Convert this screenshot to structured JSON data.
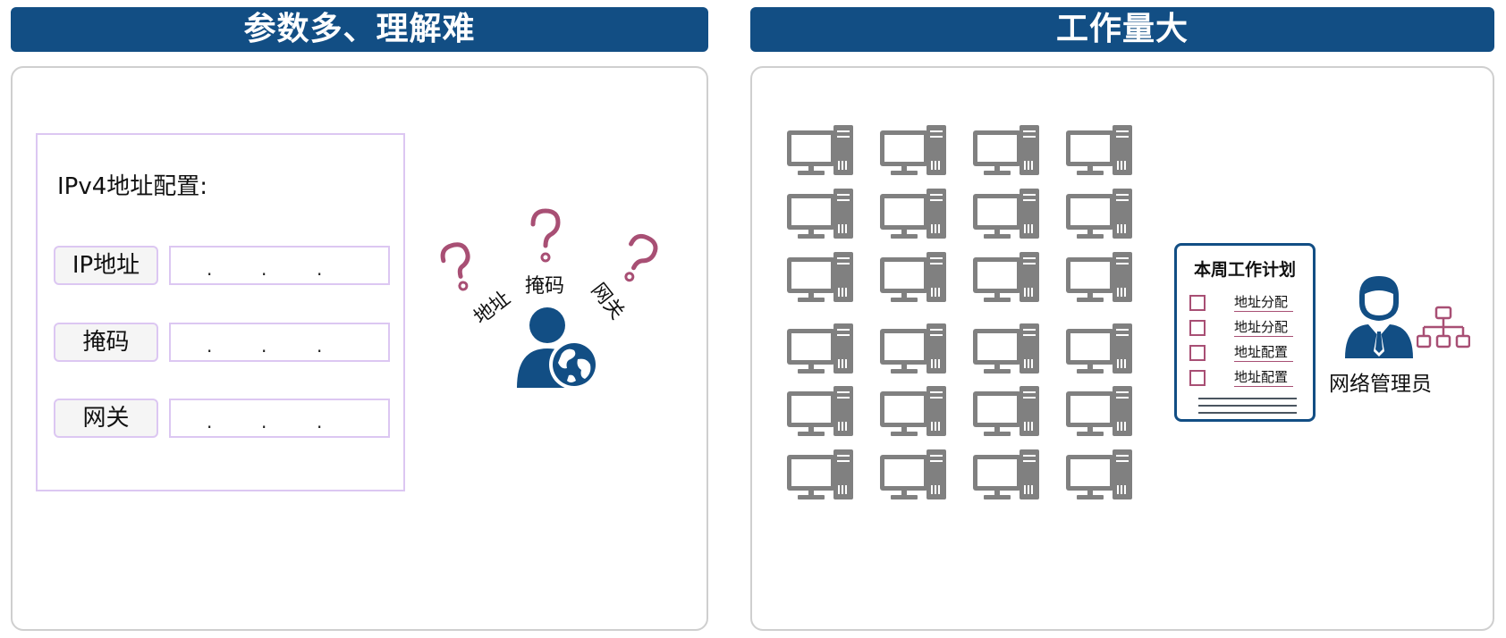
{
  "left_panel": {
    "header": "参数多、理解难",
    "config_title": "IPv4地址配置:",
    "fields": [
      {
        "label": "IP地址",
        "placeholder_dots": "."
      },
      {
        "label": "掩码",
        "placeholder_dots": "."
      },
      {
        "label": "网关",
        "placeholder_dots": "."
      }
    ],
    "question_words": [
      "地址",
      "掩码",
      "网关"
    ],
    "icons": [
      "question-mark-icon",
      "user-globe-icon"
    ],
    "colors": {
      "header": "#124e84",
      "question": "#a84f74",
      "box_border": "#dcc7f2",
      "user": "#124e84"
    }
  },
  "right_panel": {
    "header": "工作量大",
    "computer_grid": {
      "rows": 6,
      "cols": 4,
      "icon": "desktop-computer-icon",
      "color": "#808080"
    },
    "plan": {
      "title": "本周工作计划",
      "tasks": [
        "地址分配",
        "地址分配",
        "地址配置",
        "地址配置"
      ]
    },
    "admin_label": "网络管理员",
    "icons": [
      "network-admin-icon",
      "network-topology-icon"
    ]
  }
}
